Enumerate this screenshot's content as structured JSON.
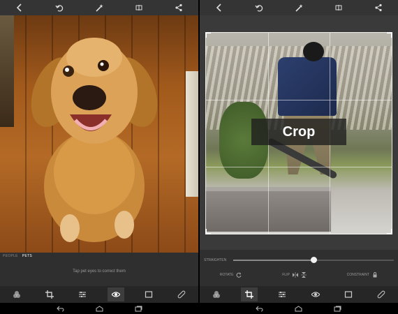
{
  "left": {
    "topbar_icons": [
      "back-icon",
      "undo-icon",
      "magic-wand-icon",
      "compare-icon",
      "share-icon"
    ],
    "mode_tabs": [
      "PEOPLE",
      "PETS"
    ],
    "active_mode": "PETS",
    "hint": "Tap pet eyes to correct them",
    "tools": [
      "effects-icon",
      "crop-icon",
      "adjust-icon",
      "eye-icon",
      "frame-icon",
      "bandage-icon"
    ],
    "active_tool": "eye-icon"
  },
  "right": {
    "topbar_icons": [
      "back-icon",
      "undo-icon",
      "magic-wand-icon",
      "compare-icon",
      "share-icon"
    ],
    "crop_label": "Crop",
    "straighten_label": "STRAIGHTEN",
    "straighten_value": 0.5,
    "rotate_label": "ROTATE",
    "flip_label": "FLIP",
    "constraint_label": "CONSTRAINT",
    "tools": [
      "effects-icon",
      "crop-icon",
      "adjust-icon",
      "eye-icon",
      "frame-icon",
      "bandage-icon"
    ],
    "active_tool": "crop-icon"
  },
  "system_nav": [
    "back-nav-icon",
    "home-nav-icon",
    "recents-nav-icon"
  ]
}
